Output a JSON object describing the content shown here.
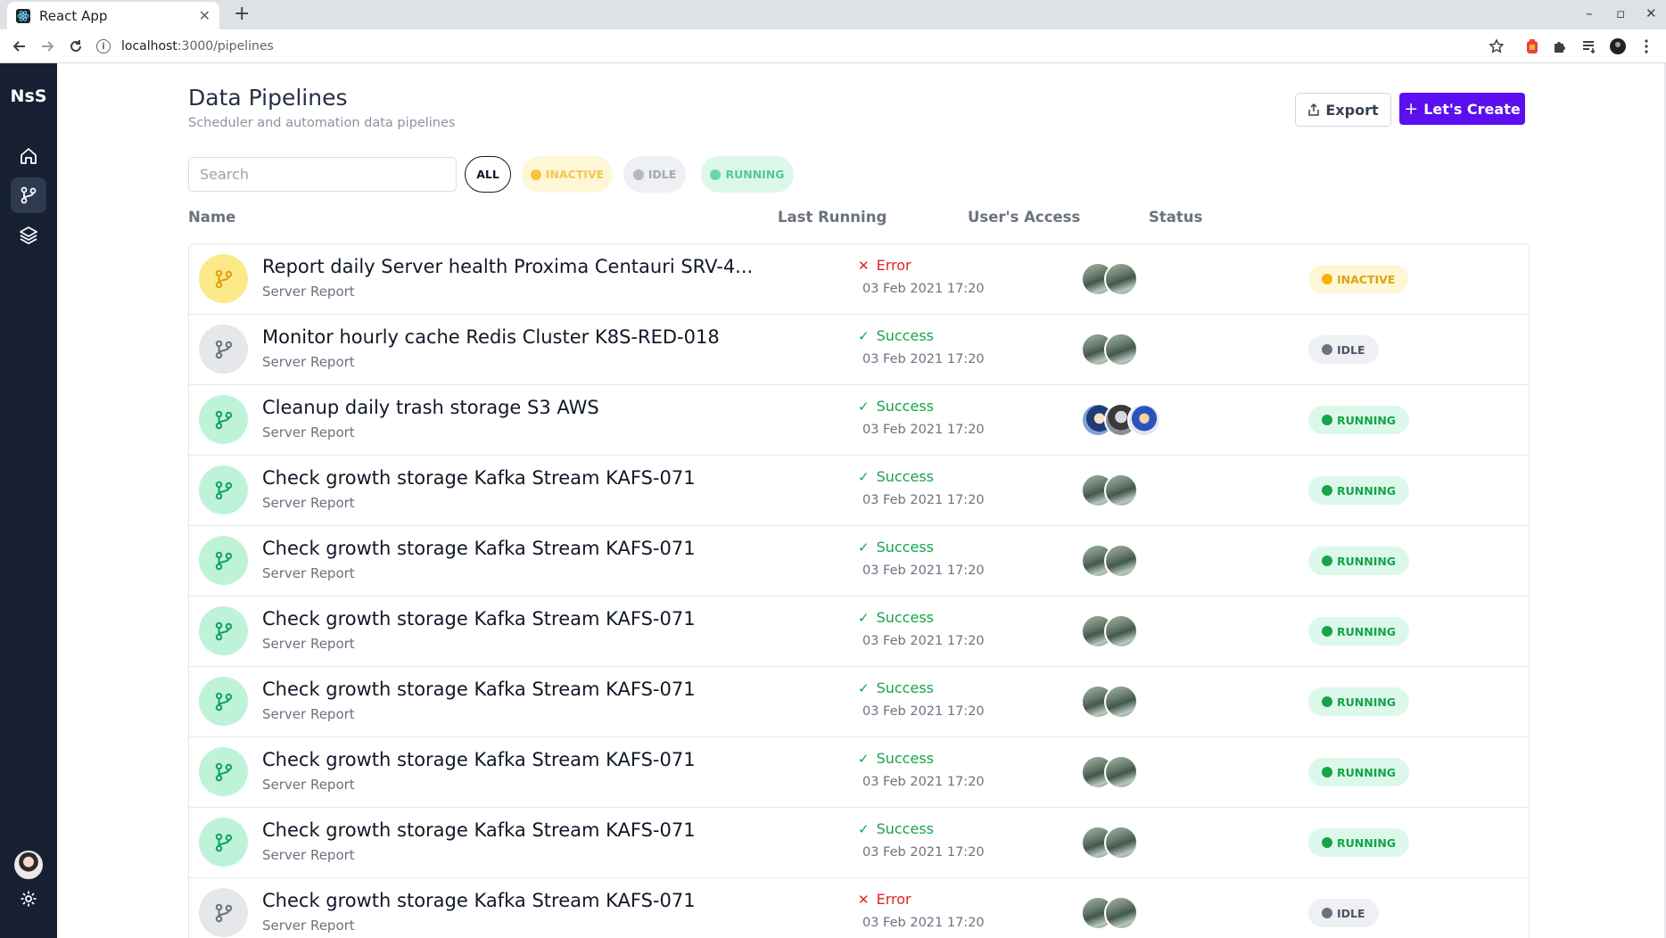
{
  "browser": {
    "tab_title": "React App",
    "tab_close": "✕",
    "new_tab": "+",
    "url_host": "localhost",
    "url_path": ":3000/pipelines",
    "controls": {
      "minimize": "–",
      "maximize": "▫",
      "close": "✕"
    }
  },
  "sidebar": {
    "logo": "NsS",
    "items": [
      {
        "name": "home",
        "icon": "home-icon"
      },
      {
        "name": "pipelines",
        "icon": "git-branch-icon",
        "active": true
      },
      {
        "name": "layers",
        "icon": "layers-icon"
      }
    ]
  },
  "header": {
    "title": "Data Pipelines",
    "subtitle": "Scheduler and automation data pipelines",
    "export_label": "Export",
    "create_label": "Let's Create",
    "create_plus": "+"
  },
  "filters": {
    "search_placeholder": "Search",
    "all": "ALL",
    "inactive": "INACTIVE",
    "idle": "IDLE",
    "running": "RUNNING"
  },
  "columns": {
    "name": "Name",
    "last_running": "Last Running",
    "users_access": "User's Access",
    "status": "Status"
  },
  "colors": {
    "accent": "#5b0ff0",
    "sidebar_bg": "#172033",
    "running": "#16a34a",
    "inactive": "#f5b300",
    "idle": "#6b7280",
    "error": "#dc2626"
  },
  "pipelines": [
    {
      "name": "Report daily Server health Proxima Centauri SRV-4...",
      "subtitle": "Server Report",
      "result": "Error",
      "date": "03 Feb 2021 17:20",
      "users": [
        "landscape",
        "landscape"
      ],
      "status": "INACTIVE",
      "kind": "inactive"
    },
    {
      "name": "Monitor hourly cache Redis Cluster K8S-RED-018",
      "subtitle": "Server Report",
      "result": "Success",
      "date": "03 Feb 2021 17:20",
      "users": [
        "landscape",
        "landscape"
      ],
      "status": "IDLE",
      "kind": "idle"
    },
    {
      "name": "Cleanup daily trash storage S3 AWS",
      "subtitle": "Server Report",
      "result": "Success",
      "date": "03 Feb 2021 17:20",
      "users": [
        "a",
        "b",
        "c"
      ],
      "status": "RUNNING",
      "kind": "running"
    },
    {
      "name": "Check growth storage Kafka Stream KAFS-071",
      "subtitle": "Server Report",
      "result": "Success",
      "date": "03 Feb 2021 17:20",
      "users": [
        "landscape",
        "landscape"
      ],
      "status": "RUNNING",
      "kind": "running"
    },
    {
      "name": "Check growth storage Kafka Stream KAFS-071",
      "subtitle": "Server Report",
      "result": "Success",
      "date": "03 Feb 2021 17:20",
      "users": [
        "landscape",
        "landscape"
      ],
      "status": "RUNNING",
      "kind": "running"
    },
    {
      "name": "Check growth storage Kafka Stream KAFS-071",
      "subtitle": "Server Report",
      "result": "Success",
      "date": "03 Feb 2021 17:20",
      "users": [
        "landscape",
        "landscape"
      ],
      "status": "RUNNING",
      "kind": "running"
    },
    {
      "name": "Check growth storage Kafka Stream KAFS-071",
      "subtitle": "Server Report",
      "result": "Success",
      "date": "03 Feb 2021 17:20",
      "users": [
        "landscape",
        "landscape"
      ],
      "status": "RUNNING",
      "kind": "running"
    },
    {
      "name": "Check growth storage Kafka Stream KAFS-071",
      "subtitle": "Server Report",
      "result": "Success",
      "date": "03 Feb 2021 17:20",
      "users": [
        "landscape",
        "landscape"
      ],
      "status": "RUNNING",
      "kind": "running"
    },
    {
      "name": "Check growth storage Kafka Stream KAFS-071",
      "subtitle": "Server Report",
      "result": "Success",
      "date": "03 Feb 2021 17:20",
      "users": [
        "landscape",
        "landscape"
      ],
      "status": "RUNNING",
      "kind": "running"
    },
    {
      "name": "Check growth storage Kafka Stream KAFS-071",
      "subtitle": "Server Report",
      "result": "Error",
      "date": "03 Feb 2021 17:20",
      "users": [
        "landscape",
        "landscape"
      ],
      "status": "IDLE",
      "kind": "idle"
    }
  ]
}
